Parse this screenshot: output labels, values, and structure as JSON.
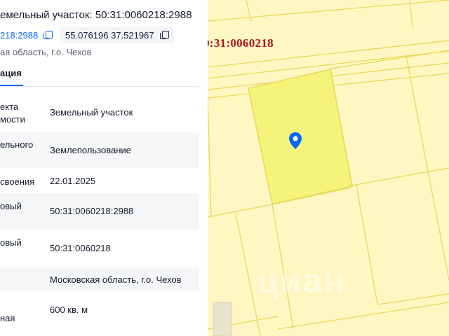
{
  "header": {
    "title": "емельный участок: 50:31:0060218:2988",
    "cadastral_chip": "218:2988",
    "coords_chip": "55.076196 37.521967",
    "subaddress": "ая область, г.о. Чехов"
  },
  "tabs": {
    "active": "ация"
  },
  "rows": [
    {
      "label": "екта\nмости",
      "value": "Земельный участок"
    },
    {
      "label": "ельного",
      "value": "Землепользование"
    },
    {
      "label": "своения",
      "value": "22.01.2025"
    },
    {
      "label": "овый",
      "value": "50:31:0060218:2988"
    },
    {
      "label": "овый",
      "value": "50:31:0060218"
    },
    {
      "label": "",
      "value": "Московская область, г.о. Чехов"
    },
    {
      "label": "\nная",
      "value": "600 кв. м"
    }
  ],
  "map": {
    "quarter_label": "0:31:0060218",
    "watermark": "циан"
  },
  "colors": {
    "link": "#0468ff",
    "map_bg": "#fff7c2",
    "parcel_line": "#e8d85a",
    "selected_parcel": "#f6f37a",
    "label_red": "#b0141b",
    "pin": "#0468ff"
  },
  "icons": [
    "copy-icon",
    "location-pin-icon"
  ]
}
